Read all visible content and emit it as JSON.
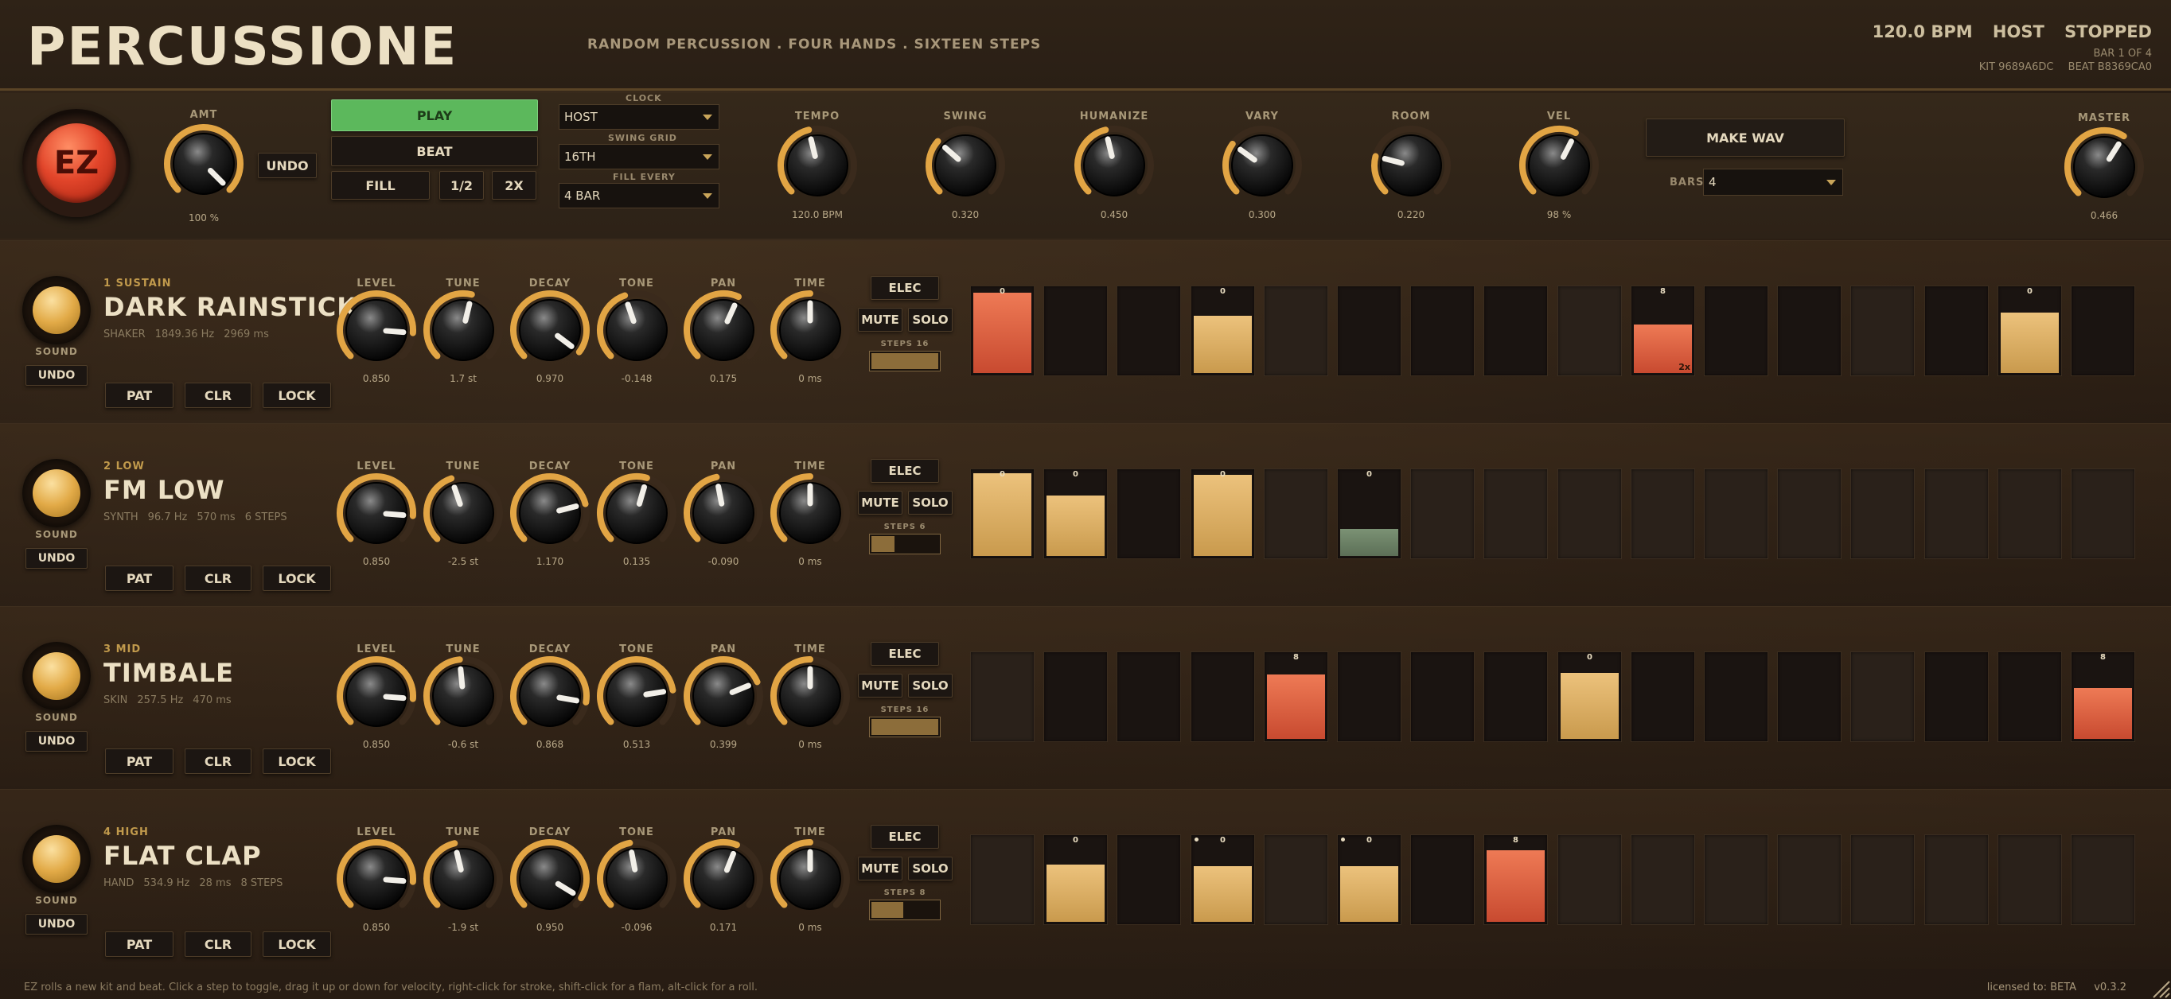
{
  "header": {
    "title": "PERCUSSIONE",
    "subtitle": "RANDOM PERCUSSION  .  FOUR HANDS  .  SIXTEEN STEPS",
    "bpm": "120.0 BPM",
    "clock_source": "HOST",
    "state": "STOPPED",
    "bar_position": "BAR 1 OF 4",
    "kit_id": "KIT 9689A6DC",
    "beat_id": "BEAT B8369CA0"
  },
  "transport": {
    "ez_label": "EZ",
    "amt": {
      "label": "AMT",
      "value": "100 %",
      "level": 1.0
    },
    "undo_label": "UNDO",
    "play_label": "PLAY",
    "beat_label": "BEAT",
    "fill_label": "FILL",
    "half_label": "1/2",
    "double_label": "2X",
    "clock": {
      "label": "CLOCK",
      "value": "HOST"
    },
    "swing_grid": {
      "label": "SWING GRID",
      "value": "16TH"
    },
    "fill_every": {
      "label": "FILL EVERY",
      "value": "4 BAR"
    },
    "knobs": [
      {
        "label": "TEMPO",
        "value": "120.0 BPM",
        "level": 0.45
      },
      {
        "label": "SWING",
        "value": "0.320",
        "level": 0.32
      },
      {
        "label": "HUMANIZE",
        "value": "0.450",
        "level": 0.45
      },
      {
        "label": "VARY",
        "value": "0.300",
        "level": 0.3
      },
      {
        "label": "ROOM",
        "value": "0.220",
        "level": 0.22
      },
      {
        "label": "VEL",
        "value": "98 %",
        "level": 0.6
      }
    ],
    "make_wav_label": "MAKE WAV",
    "bars": {
      "label": "BARS",
      "value": "4"
    },
    "master": {
      "label": "MASTER",
      "value": "0.466",
      "level": 0.62
    }
  },
  "track_controls": {
    "sound_label": "SOUND",
    "undo_label": "UNDO",
    "pat_label": "PAT",
    "clr_label": "CLR",
    "lock_label": "LOCK",
    "elec_label": "ELEC",
    "mute_label": "MUTE",
    "solo_label": "SOLO",
    "knob_labels": [
      "LEVEL",
      "TUNE",
      "DECAY",
      "TONE",
      "PAN",
      "TIME"
    ]
  },
  "colors": {
    "accent": "#e2a544",
    "orange_step": "#e06040",
    "tan_step": "#e3b36a",
    "green_step": "#6f8468",
    "play": "#5cb85c"
  },
  "tracks": [
    {
      "num": "1 SUSTAIN",
      "name": "DARK RAINSTICK",
      "info": [
        "SHAKER",
        "1849.36 Hz",
        "2969 ms"
      ],
      "knobs": [
        {
          "value": "0.850",
          "level": 0.85
        },
        {
          "value": "1.7 st",
          "level": 0.55
        },
        {
          "value": "0.970",
          "level": 0.97
        },
        {
          "value": "-0.148",
          "level": 0.43
        },
        {
          "value": "0.175",
          "level": 0.59
        },
        {
          "value": "0 ms",
          "level": 0.5
        }
      ],
      "steps_label": "STEPS 16",
      "steps_fraction": 1.0,
      "steps": [
        {
          "vel": 0.95,
          "color": "orange",
          "mark": "0"
        },
        {
          "vel": 0,
          "color": "none"
        },
        {
          "vel": 0,
          "color": "none"
        },
        {
          "vel": 0.68,
          "color": "tan",
          "mark": "0"
        },
        {
          "vel": 0,
          "color": "none",
          "dim": true
        },
        {
          "vel": 0,
          "color": "none"
        },
        {
          "vel": 0,
          "color": "none"
        },
        {
          "vel": 0,
          "color": "none"
        },
        {
          "vel": 0,
          "color": "none",
          "dim": true
        },
        {
          "vel": 0.58,
          "color": "orange",
          "mark": "8",
          "sub": "2x"
        },
        {
          "vel": 0,
          "color": "none"
        },
        {
          "vel": 0,
          "color": "none"
        },
        {
          "vel": 0,
          "color": "none",
          "dim": true
        },
        {
          "vel": 0,
          "color": "none"
        },
        {
          "vel": 0.72,
          "color": "tan",
          "mark": "0"
        },
        {
          "vel": 0,
          "color": "none"
        }
      ]
    },
    {
      "num": "2 LOW",
      "name": "FM LOW",
      "info": [
        "SYNTH",
        "96.7 Hz",
        "570 ms",
        "6 STEPS"
      ],
      "knobs": [
        {
          "value": "0.850",
          "level": 0.85
        },
        {
          "value": "-2.5 st",
          "level": 0.43
        },
        {
          "value": "1.170",
          "level": 0.78
        },
        {
          "value": "0.135",
          "level": 0.56
        },
        {
          "value": "-0.090",
          "level": 0.46
        },
        {
          "value": "0 ms",
          "level": 0.5
        }
      ],
      "steps_label": "STEPS 6",
      "steps_fraction": 0.375,
      "steps": [
        {
          "vel": 0.98,
          "color": "tan",
          "mark": "0"
        },
        {
          "vel": 0.72,
          "color": "tan",
          "mark": "0"
        },
        {
          "vel": 0,
          "color": "none"
        },
        {
          "vel": 0.96,
          "color": "tan",
          "mark": "0"
        },
        {
          "vel": 0,
          "color": "none",
          "dim": true
        },
        {
          "vel": 0.32,
          "color": "green",
          "mark": "0"
        },
        {
          "vel": 0,
          "color": "none",
          "dim": true
        },
        {
          "vel": 0,
          "color": "none",
          "dim": true
        },
        {
          "vel": 0,
          "color": "none",
          "dim": true
        },
        {
          "vel": 0,
          "color": "none",
          "dim": true
        },
        {
          "vel": 0,
          "color": "none",
          "dim": true
        },
        {
          "vel": 0,
          "color": "none",
          "dim": true
        },
        {
          "vel": 0,
          "color": "none",
          "dim": true
        },
        {
          "vel": 0,
          "color": "none",
          "dim": true
        },
        {
          "vel": 0,
          "color": "none",
          "dim": true
        },
        {
          "vel": 0,
          "color": "none",
          "dim": true
        }
      ]
    },
    {
      "num": "3 MID",
      "name": "TIMBALE",
      "info": [
        "SKIN",
        "257.5 Hz",
        "470 ms"
      ],
      "knobs": [
        {
          "value": "0.850",
          "level": 0.85
        },
        {
          "value": "-0.6 st",
          "level": 0.48
        },
        {
          "value": "0.868",
          "level": 0.87
        },
        {
          "value": "0.513",
          "level": 0.8
        },
        {
          "value": "0.399",
          "level": 0.75
        },
        {
          "value": "0 ms",
          "level": 0.5
        }
      ],
      "steps_label": "STEPS 16",
      "steps_fraction": 1.0,
      "steps": [
        {
          "vel": 0,
          "color": "none",
          "dim": true
        },
        {
          "vel": 0,
          "color": "none"
        },
        {
          "vel": 0,
          "color": "none"
        },
        {
          "vel": 0,
          "color": "none"
        },
        {
          "vel": 0.76,
          "color": "orange",
          "mark": "8"
        },
        {
          "vel": 0,
          "color": "none"
        },
        {
          "vel": 0,
          "color": "none"
        },
        {
          "vel": 0,
          "color": "none"
        },
        {
          "vel": 0.78,
          "color": "tan",
          "mark": "0"
        },
        {
          "vel": 0,
          "color": "none"
        },
        {
          "vel": 0,
          "color": "none"
        },
        {
          "vel": 0,
          "color": "none"
        },
        {
          "vel": 0,
          "color": "none",
          "dim": true
        },
        {
          "vel": 0,
          "color": "none"
        },
        {
          "vel": 0,
          "color": "none"
        },
        {
          "vel": 0.6,
          "color": "orange",
          "mark": "8"
        }
      ]
    },
    {
      "num": "4 HIGH",
      "name": "FLAT CLAP",
      "info": [
        "HAND",
        "534.9 Hz",
        "28 ms",
        "8 STEPS"
      ],
      "knobs": [
        {
          "value": "0.850",
          "level": 0.85
        },
        {
          "value": "-1.9 st",
          "level": 0.45
        },
        {
          "value": "0.950",
          "level": 0.95
        },
        {
          "value": "-0.096",
          "level": 0.46
        },
        {
          "value": "0.171",
          "level": 0.58
        },
        {
          "value": "0 ms",
          "level": 0.5
        }
      ],
      "steps_label": "STEPS 8",
      "steps_fraction": 0.5,
      "steps": [
        {
          "vel": 0,
          "color": "none",
          "dim": true
        },
        {
          "vel": 0.68,
          "color": "tan",
          "mark": "0"
        },
        {
          "vel": 0,
          "color": "none"
        },
        {
          "vel": 0.66,
          "color": "tan",
          "mark": "0",
          "flam": true
        },
        {
          "vel": 0,
          "color": "none",
          "dim": true
        },
        {
          "vel": 0.66,
          "color": "tan",
          "mark": "0",
          "flam": true
        },
        {
          "vel": 0,
          "color": "none"
        },
        {
          "vel": 0.85,
          "color": "orange",
          "mark": "8"
        },
        {
          "vel": 0,
          "color": "none",
          "dim": true
        },
        {
          "vel": 0,
          "color": "none",
          "dim": true
        },
        {
          "vel": 0,
          "color": "none",
          "dim": true
        },
        {
          "vel": 0,
          "color": "none",
          "dim": true
        },
        {
          "vel": 0,
          "color": "none",
          "dim": true
        },
        {
          "vel": 0,
          "color": "none",
          "dim": true
        },
        {
          "vel": 0,
          "color": "none",
          "dim": true
        },
        {
          "vel": 0,
          "color": "none",
          "dim": true
        }
      ]
    }
  ],
  "footer": {
    "hint": "EZ rolls a new kit and beat.  Click a step to toggle, drag it up or down for velocity, right-click for stroke, shift-click for a flam, alt-click for a roll.",
    "license": "licensed to: BETA",
    "version": "v0.3.2"
  }
}
